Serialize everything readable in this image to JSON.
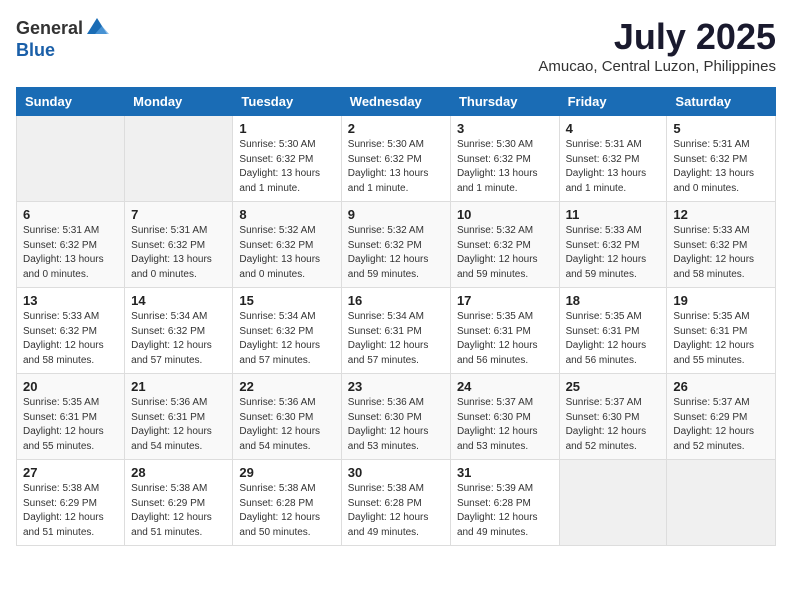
{
  "header": {
    "logo_general": "General",
    "logo_blue": "Blue",
    "month_year": "July 2025",
    "location": "Amucao, Central Luzon, Philippines"
  },
  "days_of_week": [
    "Sunday",
    "Monday",
    "Tuesday",
    "Wednesday",
    "Thursday",
    "Friday",
    "Saturday"
  ],
  "weeks": [
    [
      {
        "day": "",
        "info": ""
      },
      {
        "day": "",
        "info": ""
      },
      {
        "day": "1",
        "info": "Sunrise: 5:30 AM\nSunset: 6:32 PM\nDaylight: 13 hours and 1 minute."
      },
      {
        "day": "2",
        "info": "Sunrise: 5:30 AM\nSunset: 6:32 PM\nDaylight: 13 hours and 1 minute."
      },
      {
        "day": "3",
        "info": "Sunrise: 5:30 AM\nSunset: 6:32 PM\nDaylight: 13 hours and 1 minute."
      },
      {
        "day": "4",
        "info": "Sunrise: 5:31 AM\nSunset: 6:32 PM\nDaylight: 13 hours and 1 minute."
      },
      {
        "day": "5",
        "info": "Sunrise: 5:31 AM\nSunset: 6:32 PM\nDaylight: 13 hours and 0 minutes."
      }
    ],
    [
      {
        "day": "6",
        "info": "Sunrise: 5:31 AM\nSunset: 6:32 PM\nDaylight: 13 hours and 0 minutes."
      },
      {
        "day": "7",
        "info": "Sunrise: 5:31 AM\nSunset: 6:32 PM\nDaylight: 13 hours and 0 minutes."
      },
      {
        "day": "8",
        "info": "Sunrise: 5:32 AM\nSunset: 6:32 PM\nDaylight: 13 hours and 0 minutes."
      },
      {
        "day": "9",
        "info": "Sunrise: 5:32 AM\nSunset: 6:32 PM\nDaylight: 12 hours and 59 minutes."
      },
      {
        "day": "10",
        "info": "Sunrise: 5:32 AM\nSunset: 6:32 PM\nDaylight: 12 hours and 59 minutes."
      },
      {
        "day": "11",
        "info": "Sunrise: 5:33 AM\nSunset: 6:32 PM\nDaylight: 12 hours and 59 minutes."
      },
      {
        "day": "12",
        "info": "Sunrise: 5:33 AM\nSunset: 6:32 PM\nDaylight: 12 hours and 58 minutes."
      }
    ],
    [
      {
        "day": "13",
        "info": "Sunrise: 5:33 AM\nSunset: 6:32 PM\nDaylight: 12 hours and 58 minutes."
      },
      {
        "day": "14",
        "info": "Sunrise: 5:34 AM\nSunset: 6:32 PM\nDaylight: 12 hours and 57 minutes."
      },
      {
        "day": "15",
        "info": "Sunrise: 5:34 AM\nSunset: 6:32 PM\nDaylight: 12 hours and 57 minutes."
      },
      {
        "day": "16",
        "info": "Sunrise: 5:34 AM\nSunset: 6:31 PM\nDaylight: 12 hours and 57 minutes."
      },
      {
        "day": "17",
        "info": "Sunrise: 5:35 AM\nSunset: 6:31 PM\nDaylight: 12 hours and 56 minutes."
      },
      {
        "day": "18",
        "info": "Sunrise: 5:35 AM\nSunset: 6:31 PM\nDaylight: 12 hours and 56 minutes."
      },
      {
        "day": "19",
        "info": "Sunrise: 5:35 AM\nSunset: 6:31 PM\nDaylight: 12 hours and 55 minutes."
      }
    ],
    [
      {
        "day": "20",
        "info": "Sunrise: 5:35 AM\nSunset: 6:31 PM\nDaylight: 12 hours and 55 minutes."
      },
      {
        "day": "21",
        "info": "Sunrise: 5:36 AM\nSunset: 6:31 PM\nDaylight: 12 hours and 54 minutes."
      },
      {
        "day": "22",
        "info": "Sunrise: 5:36 AM\nSunset: 6:30 PM\nDaylight: 12 hours and 54 minutes."
      },
      {
        "day": "23",
        "info": "Sunrise: 5:36 AM\nSunset: 6:30 PM\nDaylight: 12 hours and 53 minutes."
      },
      {
        "day": "24",
        "info": "Sunrise: 5:37 AM\nSunset: 6:30 PM\nDaylight: 12 hours and 53 minutes."
      },
      {
        "day": "25",
        "info": "Sunrise: 5:37 AM\nSunset: 6:30 PM\nDaylight: 12 hours and 52 minutes."
      },
      {
        "day": "26",
        "info": "Sunrise: 5:37 AM\nSunset: 6:29 PM\nDaylight: 12 hours and 52 minutes."
      }
    ],
    [
      {
        "day": "27",
        "info": "Sunrise: 5:38 AM\nSunset: 6:29 PM\nDaylight: 12 hours and 51 minutes."
      },
      {
        "day": "28",
        "info": "Sunrise: 5:38 AM\nSunset: 6:29 PM\nDaylight: 12 hours and 51 minutes."
      },
      {
        "day": "29",
        "info": "Sunrise: 5:38 AM\nSunset: 6:28 PM\nDaylight: 12 hours and 50 minutes."
      },
      {
        "day": "30",
        "info": "Sunrise: 5:38 AM\nSunset: 6:28 PM\nDaylight: 12 hours and 49 minutes."
      },
      {
        "day": "31",
        "info": "Sunrise: 5:39 AM\nSunset: 6:28 PM\nDaylight: 12 hours and 49 minutes."
      },
      {
        "day": "",
        "info": ""
      },
      {
        "day": "",
        "info": ""
      }
    ]
  ]
}
